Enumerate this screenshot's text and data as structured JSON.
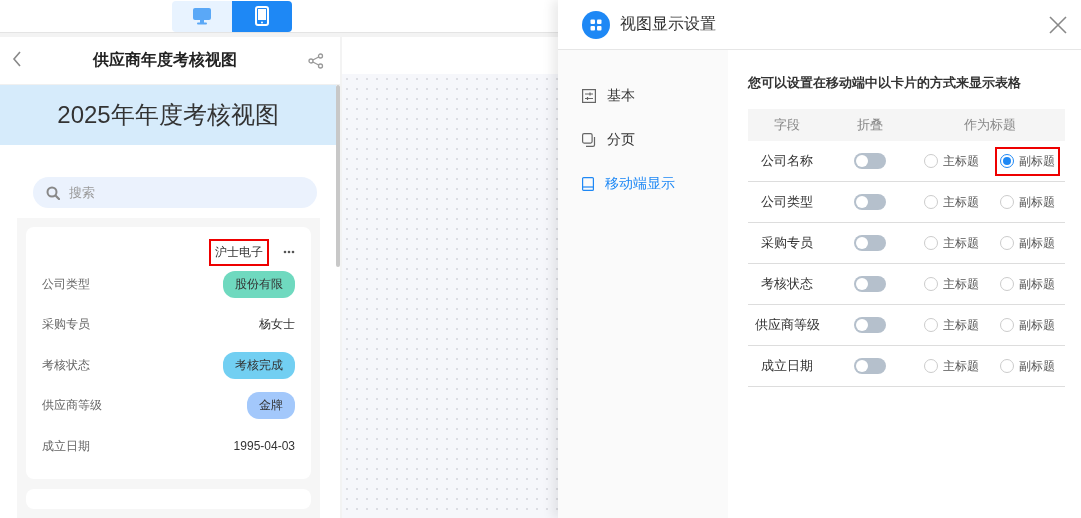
{
  "device_toggle": [
    {
      "kind": "desktop",
      "selected": false
    },
    {
      "kind": "mobile",
      "selected": true
    }
  ],
  "mobile_preview": {
    "title": "供应商年度考核视图",
    "banner": "2025年年度考核视图",
    "search": {
      "placeholder": "搜索"
    },
    "card": {
      "title": "沪士电子",
      "highlighted": true,
      "fields": [
        {
          "label": "公司类型",
          "value": "股份有限",
          "kind": "tag",
          "color": "#6fd9bf"
        },
        {
          "label": "采购专员",
          "value": "杨女士",
          "kind": "text"
        },
        {
          "label": "考核状态",
          "value": "考核完成",
          "kind": "tag",
          "color": "#72cff2"
        },
        {
          "label": "供应商等级",
          "value": "金牌",
          "kind": "tag",
          "color": "#a3c8fb"
        },
        {
          "label": "成立日期",
          "value": "1995-04-03",
          "kind": "text"
        }
      ]
    }
  },
  "settings_dialog": {
    "title": "视图显示设置",
    "sidebar": {
      "items": [
        {
          "label": "基本",
          "kind": "basic",
          "selected": false
        },
        {
          "label": "分页",
          "kind": "paging",
          "selected": false
        },
        {
          "label": "移动端显示",
          "kind": "mobile",
          "selected": true
        }
      ]
    },
    "description": "您可以设置在移动端中以卡片的方式来显示表格",
    "table": {
      "columns": [
        "字段",
        "折叠",
        "作为标题"
      ],
      "rows": [
        {
          "field": "公司名称",
          "collapse_on": false,
          "options": [
            {
              "label": "主标题",
              "selected": false,
              "highlighted": false
            },
            {
              "label": "副标题",
              "selected": true,
              "highlighted": true
            }
          ]
        },
        {
          "field": "公司类型",
          "collapse_on": false,
          "options": [
            {
              "label": "主标题",
              "selected": false,
              "highlighted": false
            },
            {
              "label": "副标题",
              "selected": false,
              "highlighted": false
            }
          ]
        },
        {
          "field": "采购专员",
          "collapse_on": false,
          "options": [
            {
              "label": "主标题",
              "selected": false,
              "highlighted": false
            },
            {
              "label": "副标题",
              "selected": false,
              "highlighted": false
            }
          ]
        },
        {
          "field": "考核状态",
          "collapse_on": false,
          "options": [
            {
              "label": "主标题",
              "selected": false,
              "highlighted": false
            },
            {
              "label": "副标题",
              "selected": false,
              "highlighted": false
            }
          ]
        },
        {
          "field": "供应商等级",
          "collapse_on": false,
          "options": [
            {
              "label": "主标题",
              "selected": false,
              "highlighted": false
            },
            {
              "label": "副标题",
              "selected": false,
              "highlighted": false
            }
          ]
        },
        {
          "field": "成立日期",
          "collapse_on": false,
          "options": [
            {
              "label": "主标题",
              "selected": false,
              "highlighted": false
            },
            {
              "label": "副标题",
              "selected": false,
              "highlighted": false
            }
          ]
        }
      ]
    }
  }
}
